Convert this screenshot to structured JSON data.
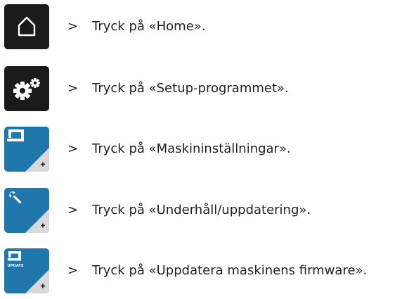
{
  "steps": [
    {
      "icon": "home-icon",
      "arrow": ">",
      "text": "Tryck på «Home»."
    },
    {
      "icon": "gears-icon",
      "arrow": ">",
      "text": "Tryck på «Setup-programmet»."
    },
    {
      "icon": "sewing-machine-icon",
      "arrow": ">",
      "text": "Tryck på «Maskininställningar»."
    },
    {
      "icon": "wrench-icon",
      "arrow": ">",
      "text": "Tryck på «Underhåll/uppdatering»."
    },
    {
      "icon": "update-icon",
      "arrow": ">",
      "text": "Tryck på «Uppdatera maskinens firmware»."
    }
  ],
  "update_label": "UPDATE",
  "colors": {
    "dark_button": "#1b1b1b",
    "blue_button": "#1f77ac",
    "corner_triangle": "#d9d9d9"
  }
}
